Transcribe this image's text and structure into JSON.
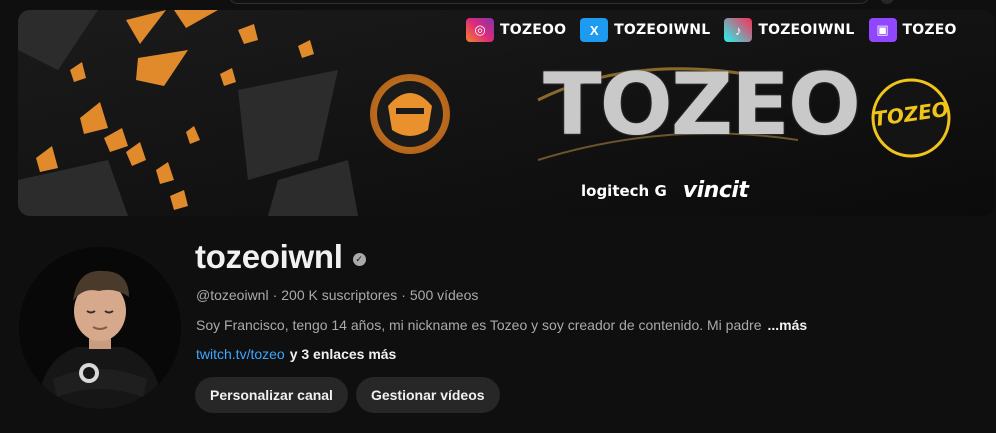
{
  "banner": {
    "socials": [
      {
        "icon": "instagram-icon",
        "handle": "TOZEOO",
        "color": "#e1306c"
      },
      {
        "icon": "x-icon",
        "handle": "TOZEOIWNL",
        "color": "#1d9bf0"
      },
      {
        "icon": "tiktok-icon",
        "handle": "TOZEOIWNL",
        "color": "#25f4ee"
      },
      {
        "icon": "twitch-icon",
        "handle": "TOZEO",
        "color": "#9146ff"
      }
    ],
    "title": "TOZEO",
    "logo_text": "TOZEO",
    "sponsors": [
      "logitech G",
      "vincit"
    ],
    "accent": "#e8912d"
  },
  "channel": {
    "name": "tozeoiwnl",
    "handle": "@tozeoiwnl",
    "subscribers": "200 K suscriptores",
    "videos": "500 vídeos",
    "separator": "·",
    "description": "Soy Francisco, tengo 14 años,  mi nickname es Tozeo y soy creador de contenido. Mi padre",
    "more": "...más",
    "link": "twitch.tv/tozeo",
    "links_more": "y 3 enlaces más"
  },
  "actions": {
    "customize": "Personalizar canal",
    "manage": "Gestionar vídeos"
  }
}
